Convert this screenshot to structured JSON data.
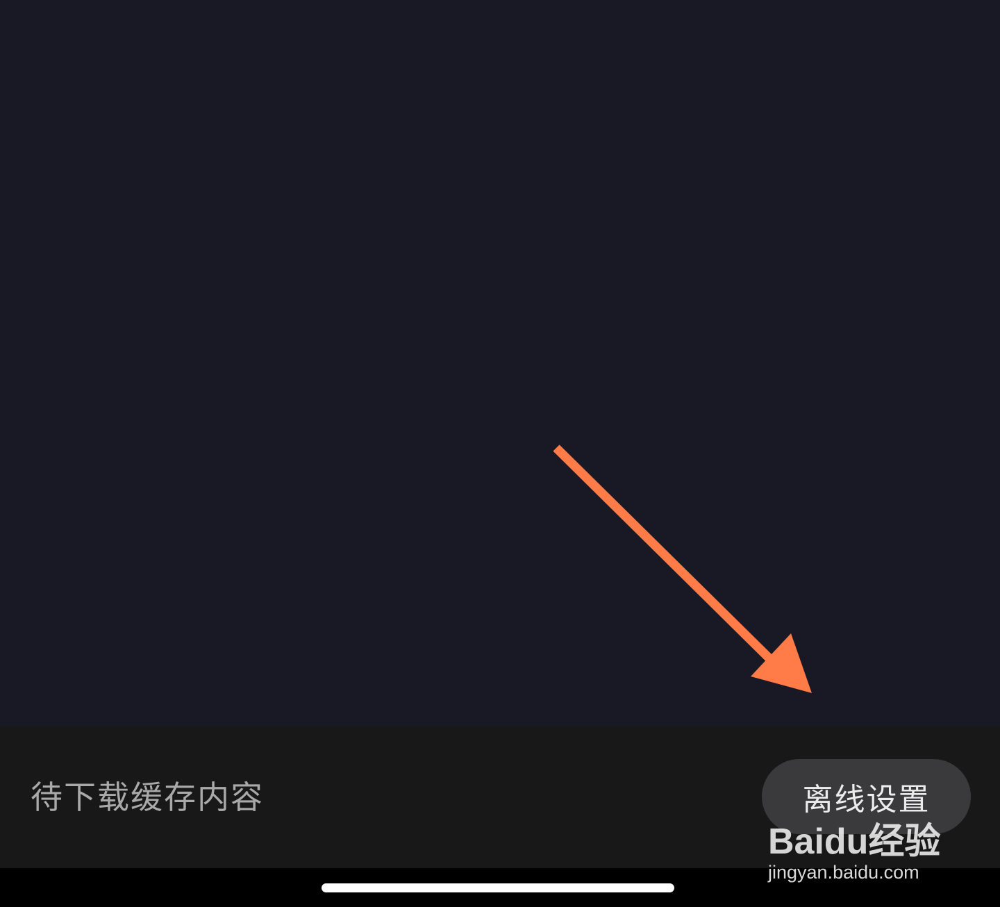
{
  "colors": {
    "content_bg": "#181925",
    "bottom_bar_bg": "#181818",
    "gesture_bg": "#000000",
    "pending_text": "#a9a9a9",
    "button_bg": "#3a3a3c",
    "button_text": "#ececec",
    "arrow": "#ff7b48",
    "home_indicator": "#ffffff",
    "watermark": "#ffffff"
  },
  "bottom_bar": {
    "pending_label": "待下载缓存内容",
    "offline_settings_label": "离线设置"
  },
  "annotation": {
    "arrow_icon": "arrow-down-right-icon"
  },
  "watermark": {
    "logo_text": "Baidu经验",
    "url": "jingyan.baidu.com"
  }
}
